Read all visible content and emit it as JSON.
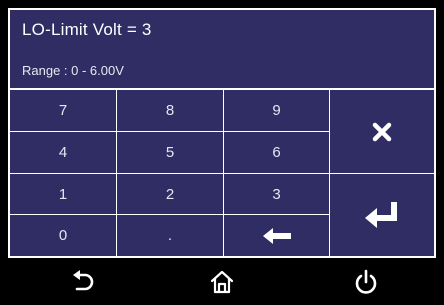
{
  "header": {
    "title": "LO-Limit Volt = 3",
    "range": "Range : 0 - 6.00V"
  },
  "keypad": {
    "rows": [
      [
        "7",
        "8",
        "9"
      ],
      [
        "4",
        "5",
        "6"
      ],
      [
        "1",
        "2",
        "3"
      ],
      [
        "0",
        ".",
        ""
      ]
    ],
    "backspace_icon": "left-arrow-icon",
    "cancel_icon": "x-icon",
    "enter_icon": "enter-icon"
  },
  "nav": {
    "back_icon": "undo-arrow-icon",
    "home_icon": "home-icon",
    "power_icon": "power-icon"
  },
  "colors": {
    "panel": "#2f2d63",
    "background": "#000000",
    "text": "#ffffff"
  }
}
